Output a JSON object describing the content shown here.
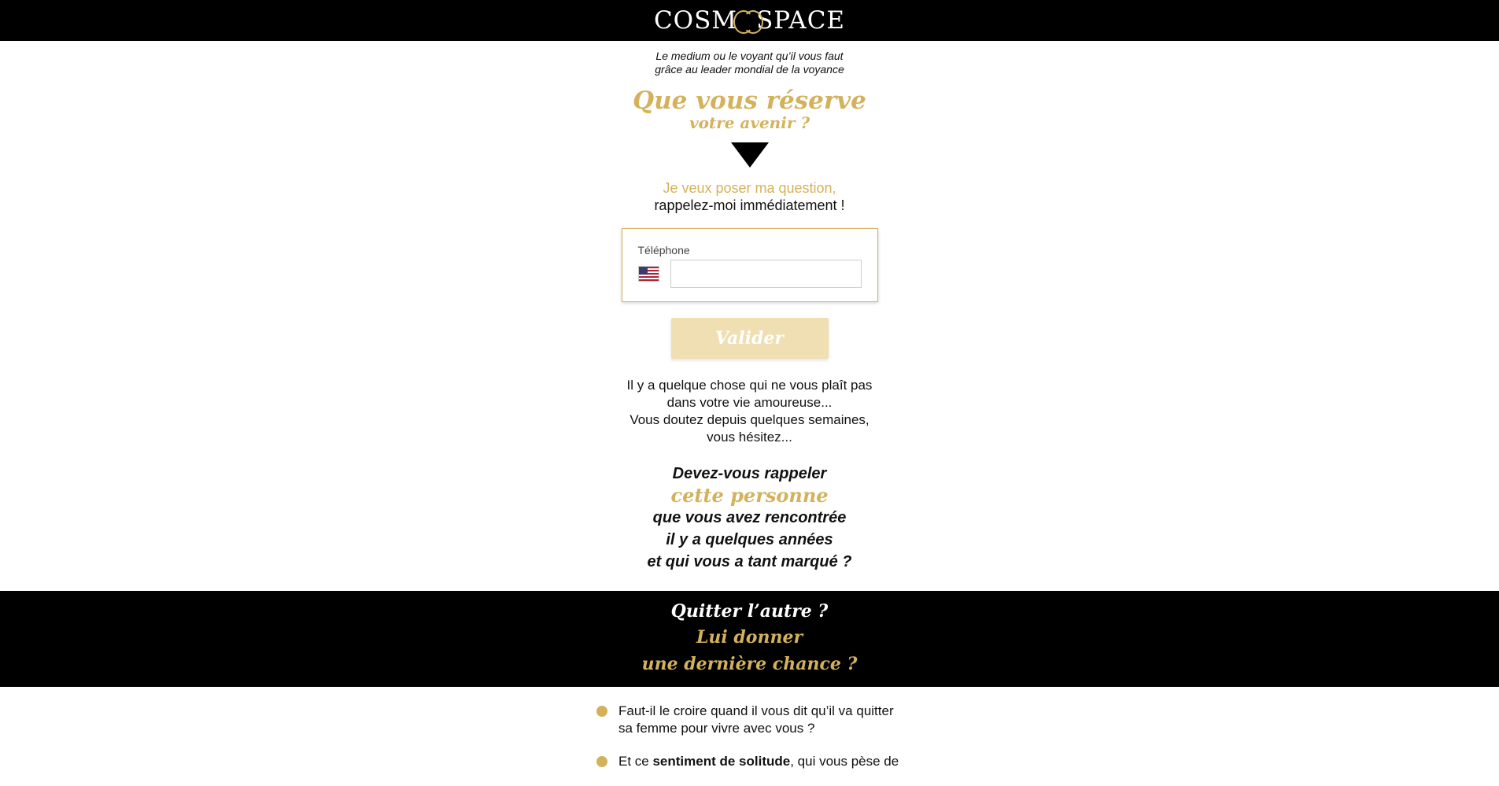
{
  "header": {
    "logo_left": "COSM",
    "logo_right": "SPACE"
  },
  "intro": {
    "tagline_line1": "Le medium ou le voyant qu’il vous faut",
    "tagline_line2": "grâce au leader mondial de la voyance",
    "headline_line1": "Que vous réserve",
    "headline_line2": "votre avenir ?"
  },
  "cta": {
    "line1": "Je veux poser ma question,",
    "line2": "rappelez-moi immédiatement !"
  },
  "form": {
    "phone_label": "Téléphone",
    "phone_value": "",
    "phone_placeholder": "",
    "country_icon": "us-flag-icon",
    "submit_label": "Valider"
  },
  "body": {
    "line1": "Il y a quelque chose qui ne vous plaît pas",
    "line2": "dans votre vie amoureuse...",
    "line3": "Vous doutez depuis quelques semaines,",
    "line4": "vous hésitez..."
  },
  "question": {
    "line1": "Devez-vous rappeler",
    "line2": "cette personne",
    "line3": "que vous avez rencontrée",
    "line4": "il y a quelques années",
    "line5": "et qui vous a tant marqué ?"
  },
  "band": {
    "line1": "Quitter l’autre ?",
    "line2": "Lui donner",
    "line3": "une dernière chance ?"
  },
  "bullets": [
    {
      "text_before": "Faut-il le croire quand il vous dit qu’il va quitter sa femme pour vivre avec vous ?",
      "bold": "",
      "text_after": ""
    },
    {
      "text_before": "Et ce ",
      "bold": "sentiment de solitude",
      "text_after": ", qui vous pèse de"
    }
  ],
  "colors": {
    "gold": "#d4b25c",
    "black": "#000000",
    "button_bg": "#efdfb2"
  }
}
